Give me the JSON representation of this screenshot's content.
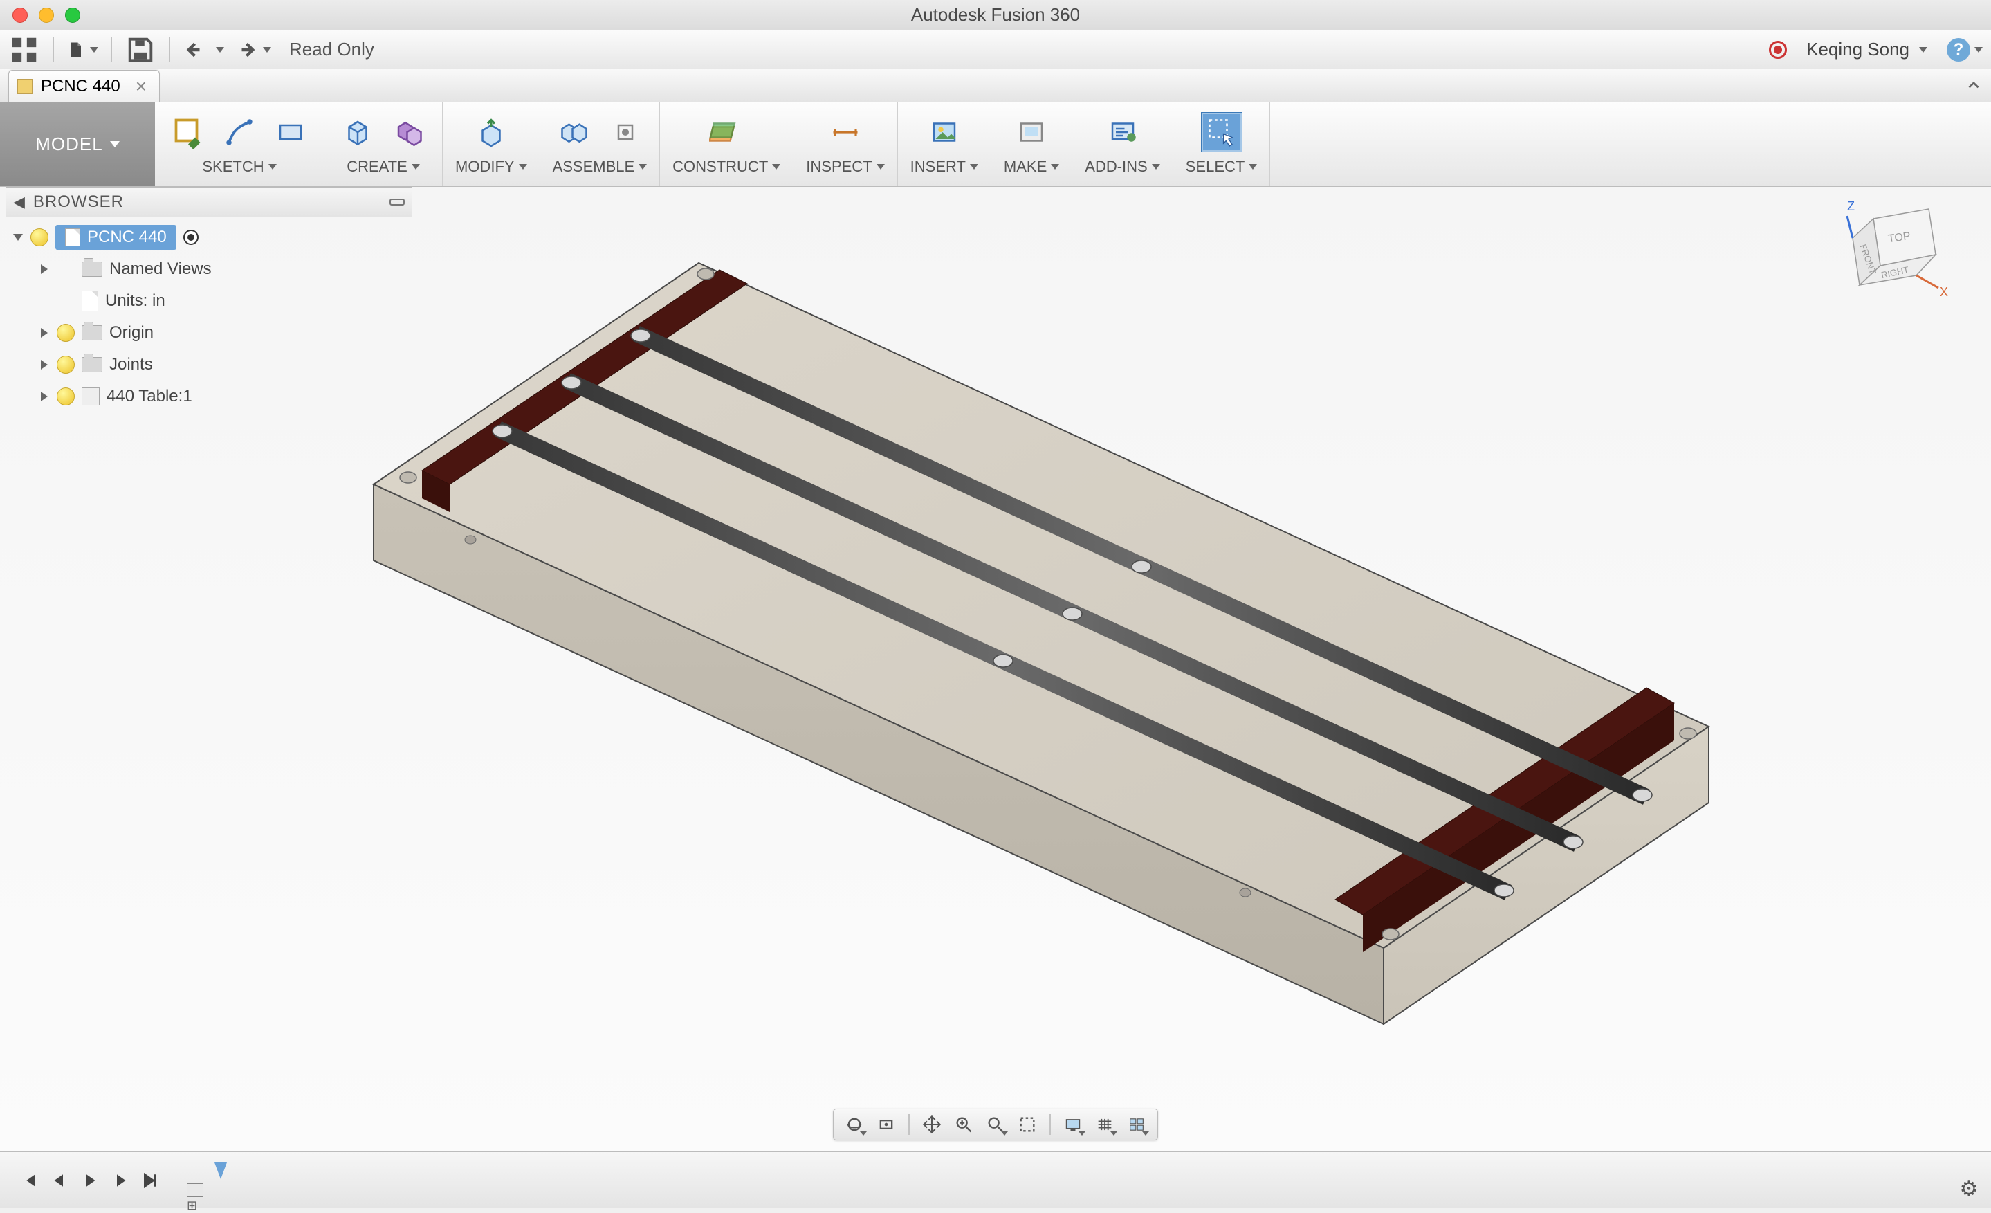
{
  "window": {
    "title": "Autodesk Fusion 360"
  },
  "qat": {
    "status": "Read Only",
    "user": "Keqing Song"
  },
  "tabs": [
    {
      "label": "PCNC 440"
    }
  ],
  "workspace": "MODEL",
  "ribbon": [
    {
      "label": "SKETCH",
      "icons": [
        "sketch",
        "line",
        "rect"
      ]
    },
    {
      "label": "CREATE",
      "icons": [
        "box",
        "pattern"
      ]
    },
    {
      "label": "MODIFY",
      "icons": [
        "pressPull"
      ]
    },
    {
      "label": "ASSEMBLE",
      "icons": [
        "joint",
        "jointOrigin"
      ]
    },
    {
      "label": "CONSTRUCT",
      "icons": [
        "plane"
      ]
    },
    {
      "label": "INSPECT",
      "icons": [
        "measure"
      ]
    },
    {
      "label": "INSERT",
      "icons": [
        "image"
      ]
    },
    {
      "label": "MAKE",
      "icons": [
        "print"
      ]
    },
    {
      "label": "ADD-INS",
      "icons": [
        "addins"
      ]
    },
    {
      "label": "SELECT",
      "icons": [
        "select"
      ],
      "active": true
    }
  ],
  "browser": {
    "title": "BROWSER",
    "root": "PCNC 440",
    "items": [
      {
        "label": "Named Views",
        "kind": "folder",
        "expandable": true
      },
      {
        "label": "Units: in",
        "kind": "doc",
        "expandable": false
      },
      {
        "label": "Origin",
        "kind": "folder",
        "expandable": true,
        "bulb": true
      },
      {
        "label": "Joints",
        "kind": "folder",
        "expandable": true,
        "bulb": true
      },
      {
        "label": "440 Table:1",
        "kind": "comp",
        "expandable": true,
        "bulb": true
      }
    ]
  },
  "viewcube": {
    "faces": {
      "top": "TOP",
      "front": "FRONT",
      "right": "RIGHT"
    },
    "axes": {
      "x": "X",
      "z": "Z"
    }
  },
  "navbar_groups": [
    [
      "orbit",
      "look",
      "pan",
      "zoom",
      "fit"
    ],
    [
      "display",
      "grid",
      "viewports"
    ]
  ]
}
